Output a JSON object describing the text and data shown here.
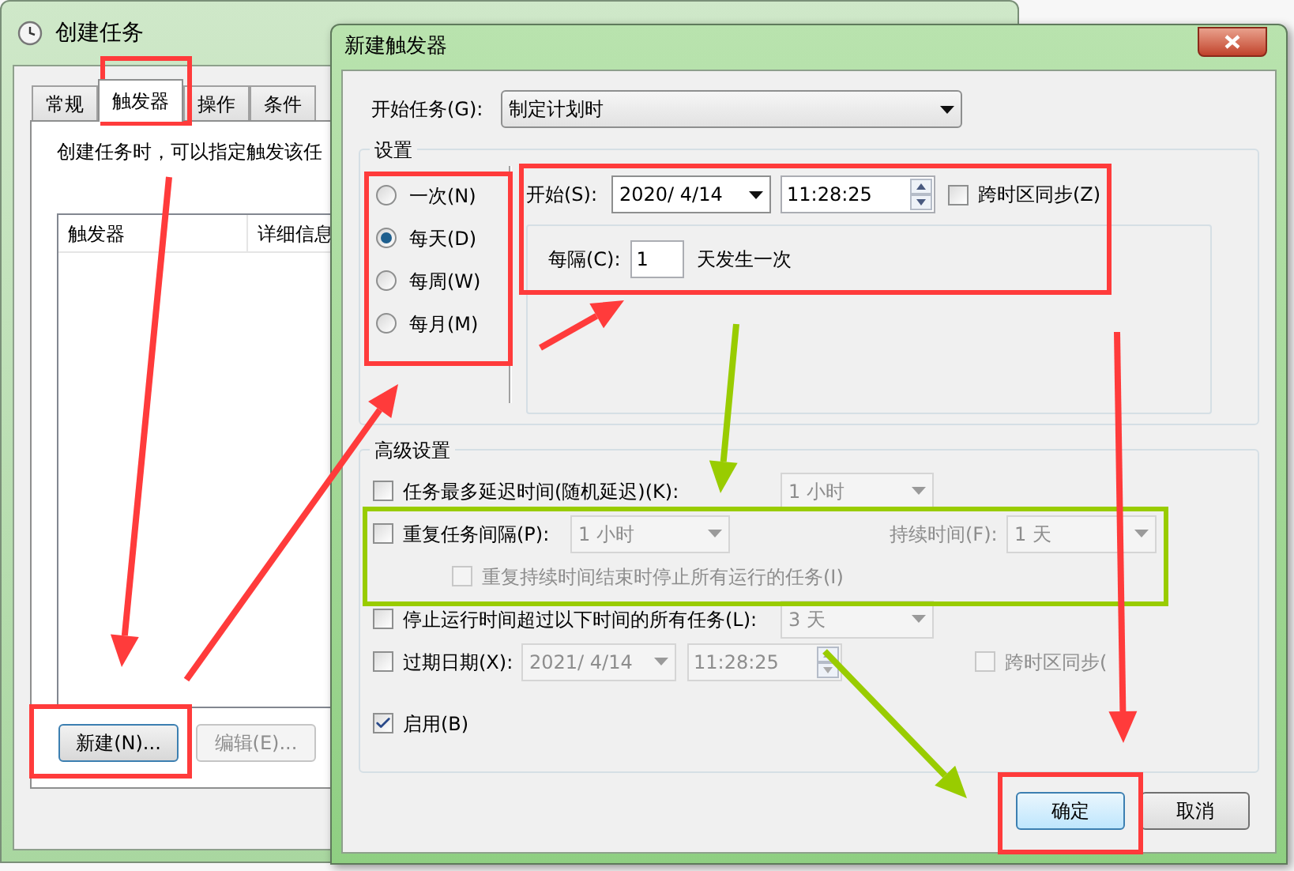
{
  "back_window": {
    "title": "创建任务",
    "tabs": [
      {
        "label": "常规",
        "selected": false
      },
      {
        "label": "触发器",
        "selected": true
      },
      {
        "label": "操作",
        "selected": false
      },
      {
        "label": "条件",
        "selected": false
      }
    ],
    "description": "创建任务时，可以指定触发该任",
    "list_columns": [
      "触发器",
      "详细信息"
    ],
    "buttons": [
      {
        "label": "新建(N)...",
        "disabled": false
      },
      {
        "label": "编辑(E)...",
        "disabled": true
      }
    ]
  },
  "dialog": {
    "title": "新建触发器",
    "begin_task": {
      "label": "开始任务(G):",
      "value": "制定计划时"
    },
    "settings": {
      "title": "设置",
      "schedule_options": [
        {
          "label": "一次(N)",
          "selected": false
        },
        {
          "label": "每天(D)",
          "selected": true
        },
        {
          "label": "每周(W)",
          "selected": false
        },
        {
          "label": "每月(M)",
          "selected": false
        }
      ],
      "start": {
        "label": "开始(S):",
        "date": "2020/  4/14",
        "time": "11:28:25",
        "sync_label": "跨时区同步(Z)",
        "sync_checked": false
      },
      "recur": {
        "label": "每隔(C):",
        "value": "1",
        "suffix": "天发生一次"
      }
    },
    "advanced": {
      "title": "高级设置",
      "rows": [
        {
          "kind": "combo",
          "label": "任务最多延迟时间(随机延迟)(K):",
          "checked": false,
          "value": "1 小时"
        },
        {
          "kind": "repeat",
          "label": "重复任务间隔(P):",
          "checked": false,
          "value": "1 小时",
          "duration_label": "持续时间(F):",
          "duration_value": "1 天",
          "stop_label": "重复持续时间结束时停止所有运行的任务(I)",
          "stop_checked": false
        },
        {
          "kind": "combo",
          "label": "停止运行时间超过以下时间的所有任务(L):",
          "checked": false,
          "value": "3 天"
        },
        {
          "kind": "expiry",
          "label": "过期日期(X):",
          "checked": false,
          "date": "2021/  4/14",
          "time": "11:28:25",
          "sync_label": "跨时区同步(",
          "sync_checked": false
        },
        {
          "kind": "enable",
          "label": "启用(B)",
          "checked": true
        }
      ]
    },
    "buttons": [
      {
        "label": "确定",
        "default": true
      },
      {
        "label": "取消",
        "default": false
      }
    ]
  }
}
